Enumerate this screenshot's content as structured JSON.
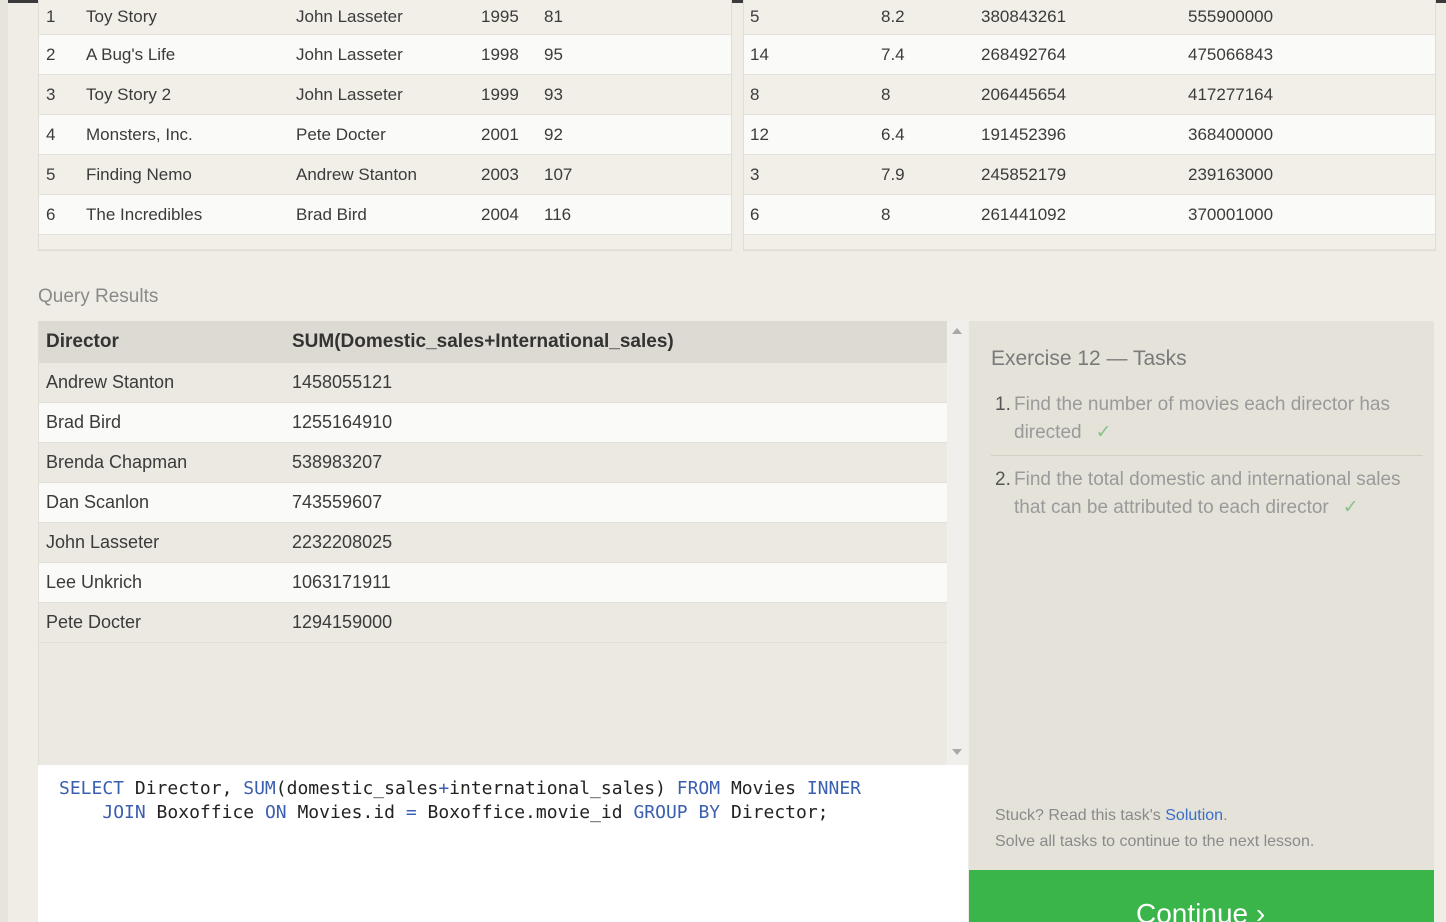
{
  "movies_table": {
    "rows": [
      {
        "id": "1",
        "title": "Toy Story",
        "director": "John Lasseter",
        "year": "1995",
        "length": "81"
      },
      {
        "id": "2",
        "title": "A Bug's Life",
        "director": "John Lasseter",
        "year": "1998",
        "length": "95"
      },
      {
        "id": "3",
        "title": "Toy Story 2",
        "director": "John Lasseter",
        "year": "1999",
        "length": "93"
      },
      {
        "id": "4",
        "title": "Monsters, Inc.",
        "director": "Pete Docter",
        "year": "2001",
        "length": "92"
      },
      {
        "id": "5",
        "title": "Finding Nemo",
        "director": "Andrew Stanton",
        "year": "2003",
        "length": "107"
      },
      {
        "id": "6",
        "title": "The Incredibles",
        "director": "Brad Bird",
        "year": "2004",
        "length": "116"
      }
    ]
  },
  "boxoffice_table": {
    "rows": [
      {
        "movie_id": "5",
        "rating": "8.2",
        "domestic": "380843261",
        "international": "555900000"
      },
      {
        "movie_id": "14",
        "rating": "7.4",
        "domestic": "268492764",
        "international": "475066843"
      },
      {
        "movie_id": "8",
        "rating": "8",
        "domestic": "206445654",
        "international": "417277164"
      },
      {
        "movie_id": "12",
        "rating": "6.4",
        "domestic": "191452396",
        "international": "368400000"
      },
      {
        "movie_id": "3",
        "rating": "7.9",
        "domestic": "245852179",
        "international": "239163000"
      },
      {
        "movie_id": "6",
        "rating": "8",
        "domestic": "261441092",
        "international": "370001000"
      }
    ]
  },
  "query_results": {
    "label": "Query Results",
    "headers": [
      "Director",
      "SUM(Domestic_sales+International_sales)"
    ],
    "rows": [
      [
        "Andrew Stanton",
        "1458055121"
      ],
      [
        "Brad Bird",
        "1255164910"
      ],
      [
        "Brenda Chapman",
        "538983207"
      ],
      [
        "Dan Scanlon",
        "743559607"
      ],
      [
        "John Lasseter",
        "2232208025"
      ],
      [
        "Lee Unkrich",
        "1063171911"
      ],
      [
        "Pete Docter",
        "1294159000"
      ]
    ]
  },
  "editor": {
    "line1": [
      "SELECT",
      " Director, ",
      "SUM",
      "(domestic_sales",
      "+",
      "international_sales) ",
      "FROM",
      " Movies ",
      "INNER"
    ],
    "line2": [
      "    ",
      "JOIN",
      " Boxoffice ",
      "ON",
      " Movies.id ",
      "=",
      " Boxoffice.movie_id ",
      "GROUP BY",
      " Director;"
    ]
  },
  "tasks": {
    "title": "Exercise 12 — Tasks",
    "items": [
      {
        "num": "1.",
        "text": "Find the number of movies each director has directed",
        "check": "✓"
      },
      {
        "num": "2.",
        "text": "Find the total domestic and international sales that can be attributed to each director",
        "check": "✓"
      }
    ],
    "stuck_prefix": "Stuck? Read this task's ",
    "solution_link": "Solution",
    "stuck_suffix": ".",
    "next_lesson": "Solve all tasks to continue to the next lesson."
  },
  "continue_button": {
    "label": "Continue ›"
  },
  "colors": {
    "accent_green": "#39b54a",
    "link_blue": "#3a6fc8",
    "keyword_blue": "#3a5fb0",
    "check_green": "#88c488"
  }
}
